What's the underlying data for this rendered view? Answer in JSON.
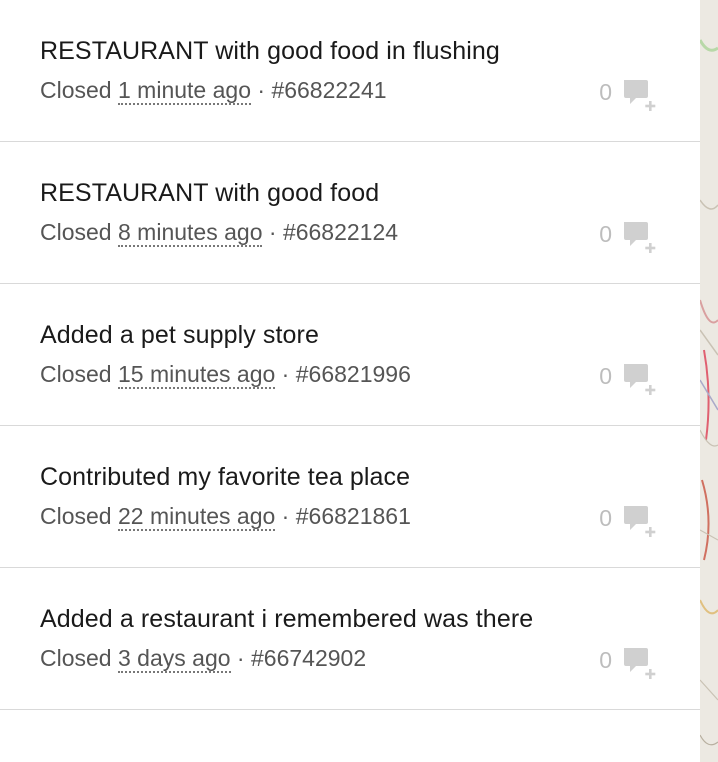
{
  "notes": [
    {
      "title": "RESTAURANT with good food in flushing",
      "status": "Closed",
      "time_ago": "1 minute ago",
      "separator": "·",
      "id": "#66822241",
      "comment_count": "0"
    },
    {
      "title": "RESTAURANT with good food",
      "status": "Closed",
      "time_ago": "8 minutes ago",
      "separator": "·",
      "id": "#66822124",
      "comment_count": "0"
    },
    {
      "title": "Added a pet supply store",
      "status": "Closed",
      "time_ago": "15 minutes ago",
      "separator": "·",
      "id": "#66821996",
      "comment_count": "0"
    },
    {
      "title": "Contributed my favorite tea place",
      "status": "Closed",
      "time_ago": "22 minutes ago",
      "separator": "·",
      "id": "#66821861",
      "comment_count": "0"
    },
    {
      "title": "Added a restaurant i remembered was there",
      "status": "Closed",
      "time_ago": "3 days ago",
      "separator": "·",
      "id": "#66742902",
      "comment_count": "0"
    }
  ],
  "icons": {
    "comment": "comment-add-icon"
  },
  "colors": {
    "title": "#1a1a1a",
    "meta": "#555555",
    "comment_icon": "#d0d0d0",
    "divider": "#d9d9d9",
    "map_background": "#ece9e2"
  }
}
